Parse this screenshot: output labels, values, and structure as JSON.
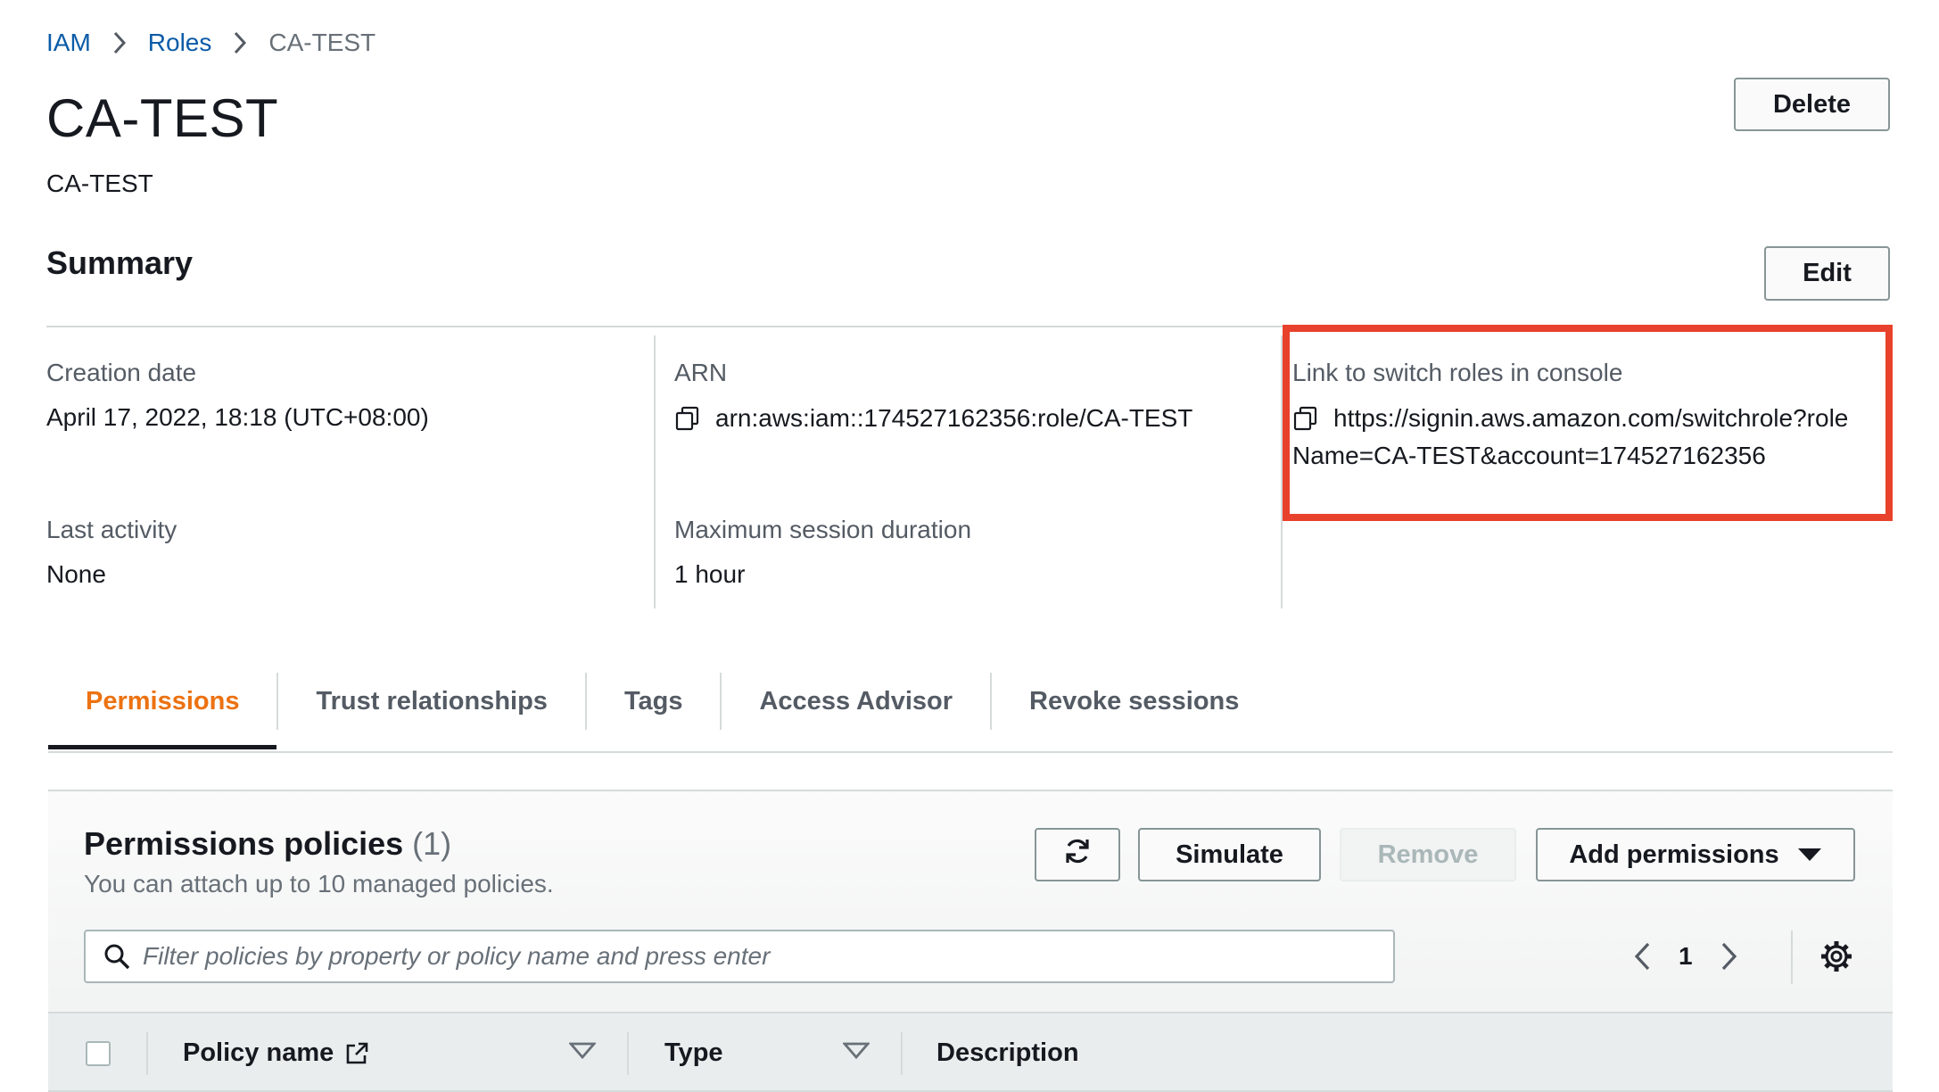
{
  "breadcrumb": {
    "iam": "IAM",
    "roles": "Roles",
    "current": "CA-TEST"
  },
  "header": {
    "title": "CA-TEST",
    "subtitle": "CA-TEST",
    "delete_label": "Delete"
  },
  "summary": {
    "title": "Summary",
    "edit_label": "Edit",
    "creation_date_label": "Creation date",
    "creation_date_value": "April 17, 2022, 18:18 (UTC+08:00)",
    "arn_label": "ARN",
    "arn_value": "arn:aws:iam::174527162356:role/CA-TEST",
    "switch_link_label": "Link to switch roles in console",
    "switch_link_line1": "https://signin.aws.amazon.com/switchrole?role",
    "switch_link_line2": "Name=CA-TEST&account=174527162356",
    "last_activity_label": "Last activity",
    "last_activity_value": "None",
    "max_session_label": "Maximum session duration",
    "max_session_value": "1 hour"
  },
  "tabs": [
    {
      "label": "Permissions",
      "active": true
    },
    {
      "label": "Trust relationships",
      "active": false
    },
    {
      "label": "Tags",
      "active": false
    },
    {
      "label": "Access Advisor",
      "active": false
    },
    {
      "label": "Revoke sessions",
      "active": false
    }
  ],
  "permissions": {
    "title": "Permissions policies",
    "count": "(1)",
    "description": "You can attach up to 10 managed policies.",
    "simulate_label": "Simulate",
    "remove_label": "Remove",
    "add_permissions_label": "Add permissions",
    "search_placeholder": "Filter policies by property or policy name and press enter",
    "page_number": "1",
    "columns": {
      "policy_name": "Policy name",
      "type": "Type",
      "description": "Description"
    }
  },
  "colors": {
    "accent": "#ec7211",
    "link": "#0b5ba7",
    "highlight": "#e8412c"
  },
  "icons": [
    "chevron-right-icon",
    "copy-icon",
    "refresh-icon",
    "caret-down-icon",
    "search-icon",
    "chevron-left-icon",
    "gear-icon",
    "external-link-icon",
    "sort-caret-icon"
  ]
}
